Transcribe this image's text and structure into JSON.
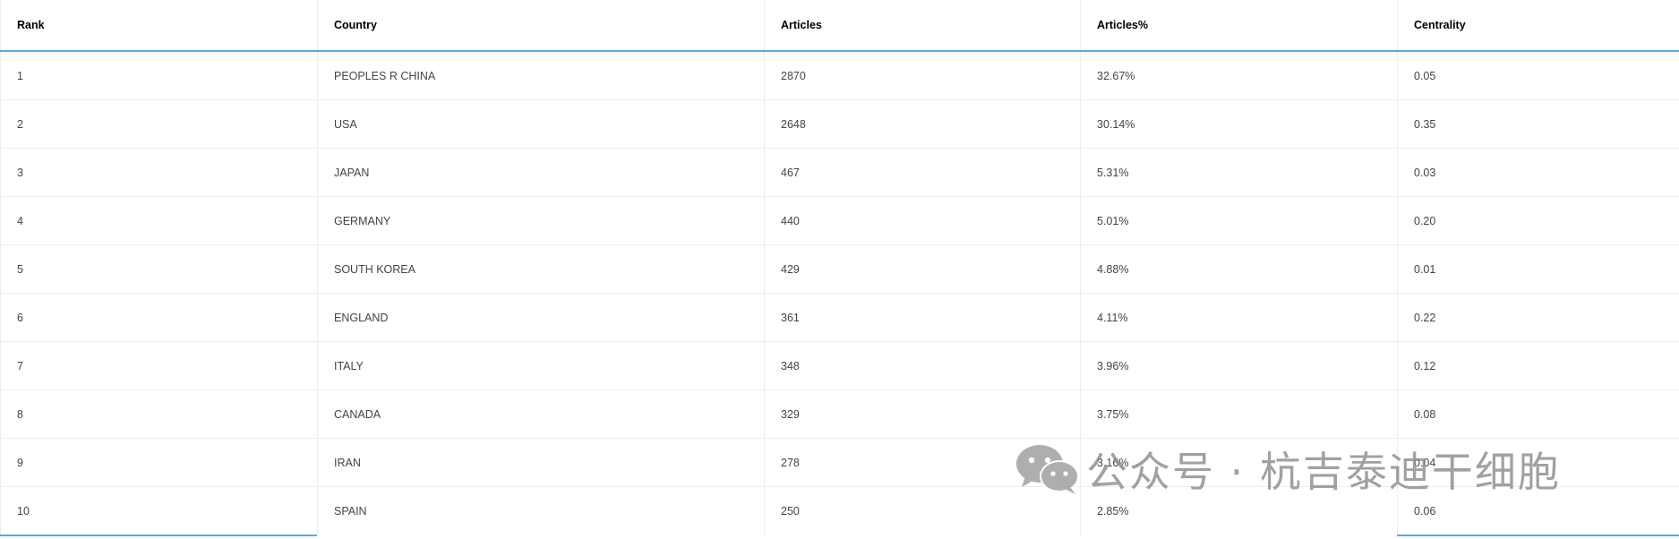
{
  "table": {
    "headers": [
      "Rank",
      "Country",
      "Articles",
      "Articles%",
      "Centrality"
    ],
    "rows": [
      [
        "1",
        "PEOPLES R CHINA",
        "2870",
        "32.67%",
        "0.05"
      ],
      [
        "2",
        "USA",
        "2648",
        "30.14%",
        "0.35"
      ],
      [
        "3",
        "JAPAN",
        "467",
        "5.31%",
        "0.03"
      ],
      [
        "4",
        "GERMANY",
        "440",
        "5.01%",
        "0.20"
      ],
      [
        "5",
        "SOUTH KOREA",
        "429",
        "4.88%",
        "0.01"
      ],
      [
        "6",
        "ENGLAND",
        "361",
        "4.11%",
        "0.22"
      ],
      [
        "7",
        "ITALY",
        "348",
        "3.96%",
        "0.12"
      ],
      [
        "8",
        "CANADA",
        "329",
        "3.75%",
        "0.08"
      ],
      [
        "9",
        "IRAN",
        "278",
        "3.16%",
        "0.04"
      ],
      [
        "10",
        "SPAIN",
        "250",
        "2.85%",
        "0.06"
      ]
    ]
  },
  "watermark": {
    "text": "公众号 · 杭吉泰迪干细胞",
    "icon": "wechat-icon"
  }
}
